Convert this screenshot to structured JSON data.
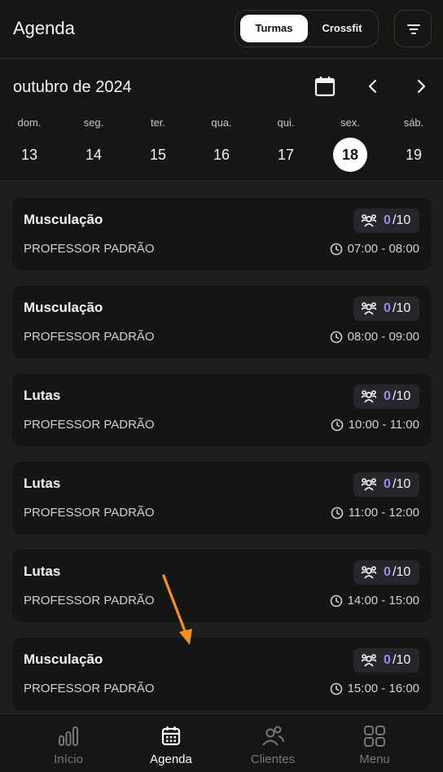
{
  "header": {
    "title": "Agenda",
    "toggle": {
      "active": "Turmas",
      "inactive": "Crossfit"
    },
    "filter_icon": "filter-icon"
  },
  "calendar": {
    "month": "outubro de 2024",
    "days": [
      {
        "name": "dom.",
        "num": "13"
      },
      {
        "name": "seg.",
        "num": "14"
      },
      {
        "name": "ter.",
        "num": "15"
      },
      {
        "name": "qua.",
        "num": "16"
      },
      {
        "name": "qui.",
        "num": "17"
      },
      {
        "name": "sex.",
        "num": "18"
      },
      {
        "name": "sáb.",
        "num": "19"
      }
    ],
    "selected_day": "18"
  },
  "classes": [
    {
      "title": "Musculação",
      "teacher": "PROFESSOR PADRÃO",
      "count": "0",
      "capacity": "/10",
      "time": "07:00 - 08:00"
    },
    {
      "title": "Musculação",
      "teacher": "PROFESSOR PADRÃO",
      "count": "0",
      "capacity": "/10",
      "time": "08:00 - 09:00"
    },
    {
      "title": "Lutas",
      "teacher": "PROFESSOR PADRÃO",
      "count": "0",
      "capacity": "/10",
      "time": "10:00 - 11:00"
    },
    {
      "title": "Lutas",
      "teacher": "PROFESSOR PADRÃO",
      "count": "0",
      "capacity": "/10",
      "time": "11:00 - 12:00"
    },
    {
      "title": "Lutas",
      "teacher": "PROFESSOR PADRÃO",
      "count": "0",
      "capacity": "/10",
      "time": "14:00 - 15:00"
    },
    {
      "title": "Musculação",
      "teacher": "PROFESSOR PADRÃO",
      "count": "0",
      "capacity": "/10",
      "time": "15:00 - 16:00"
    }
  ],
  "nav": [
    {
      "label": "Início",
      "icon": "chart-bars-icon",
      "active": false
    },
    {
      "label": "Agenda",
      "icon": "calendar-icon",
      "active": true
    },
    {
      "label": "Clientes",
      "icon": "users-icon",
      "active": false
    },
    {
      "label": "Menu",
      "icon": "grid-icon",
      "active": false
    }
  ],
  "colors": {
    "accent": "#9a87f0",
    "background": "#1c1f1b",
    "surface": "#141613",
    "annotation_arrow": "#f5921e"
  }
}
